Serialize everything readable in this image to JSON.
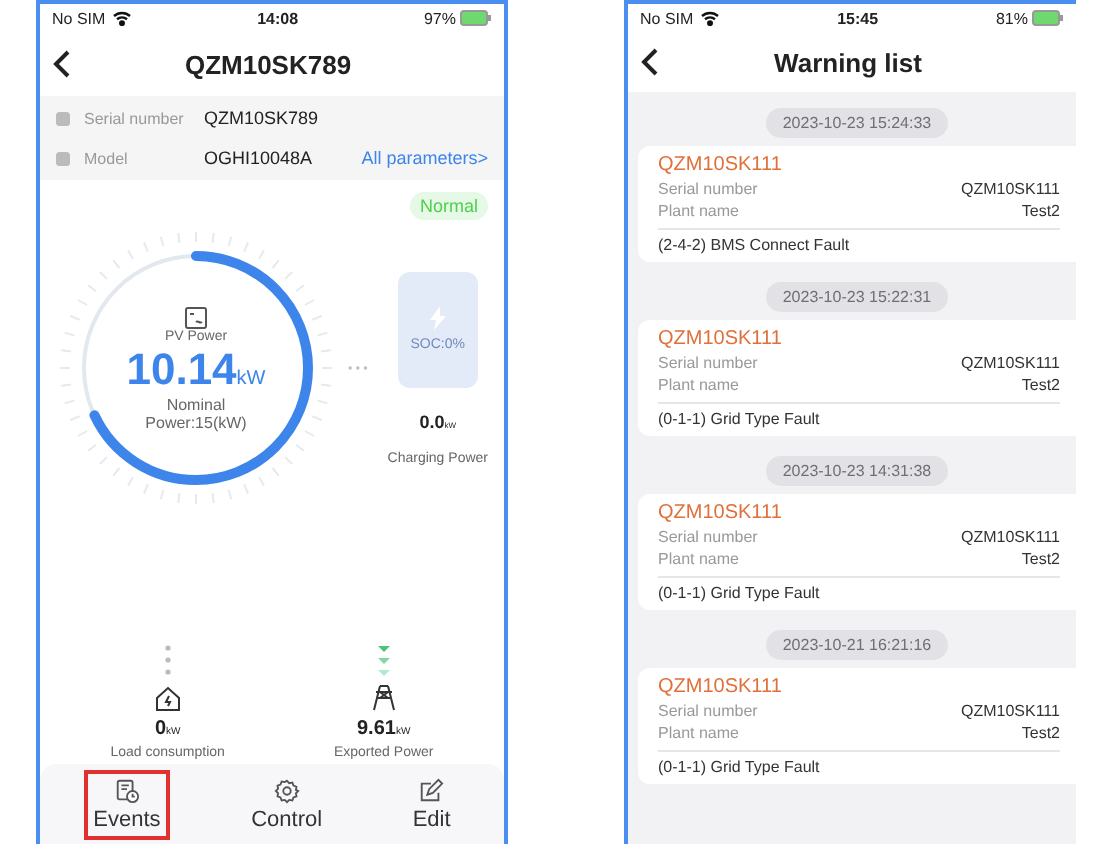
{
  "device_screen": {
    "status_bar": {
      "carrier": "No SIM",
      "time": "14:08",
      "battery": "97%"
    },
    "title": "QZM10SK789",
    "info": [
      {
        "label": "Serial number",
        "value": "QZM10SK789"
      },
      {
        "label": "Model",
        "value": "OGHI10048A",
        "link": "All parameters>"
      }
    ],
    "status_badge": "Normal",
    "pv": {
      "label": "PV Power",
      "value": "10.14",
      "unit": "kW",
      "nominal": "Nominal Power:15(kW)",
      "level": 0.68
    },
    "battery": {
      "soc": "SOC:0%",
      "value": "0.0",
      "unit": "kW",
      "label": "Charging Power"
    },
    "load": {
      "value": "0",
      "unit": "kW",
      "label": "Load consumption"
    },
    "grid": {
      "value": "9.61",
      "unit": "kW",
      "label": "Exported Power"
    },
    "tabs": [
      {
        "label": "Events",
        "kind": "events",
        "highlighted": true
      },
      {
        "label": "Control",
        "kind": "control",
        "highlighted": false
      },
      {
        "label": "Edit",
        "kind": "edit",
        "highlighted": false
      }
    ]
  },
  "warning_screen": {
    "status_bar": {
      "carrier": "No SIM",
      "time": "15:45",
      "battery": "81%"
    },
    "title": "Warning list",
    "warnings": [
      {
        "time": "2023-10-23 15:24:33",
        "device": "QZM10SK111",
        "serial_label": "Serial number",
        "serial": "QZM10SK111",
        "plant_label": "Plant name",
        "plant": "Test2",
        "fault": "(2-4-2) BMS Connect Fault"
      },
      {
        "time": "2023-10-23 15:22:31",
        "device": "QZM10SK111",
        "serial_label": "Serial number",
        "serial": "QZM10SK111",
        "plant_label": "Plant name",
        "plant": "Test2",
        "fault": "(0-1-1) Grid Type Fault"
      },
      {
        "time": "2023-10-23 14:31:38",
        "device": "QZM10SK111",
        "serial_label": "Serial number",
        "serial": "QZM10SK111",
        "plant_label": "Plant name",
        "plant": "Test2",
        "fault": "(0-1-1) Grid Type Fault"
      },
      {
        "time": "2023-10-21 16:21:16",
        "device": "QZM10SK111",
        "serial_label": "Serial number",
        "serial": "QZM10SK111",
        "plant_label": "Plant name",
        "plant": "Test2",
        "fault": "(0-1-1) Grid Type Fault"
      }
    ]
  }
}
